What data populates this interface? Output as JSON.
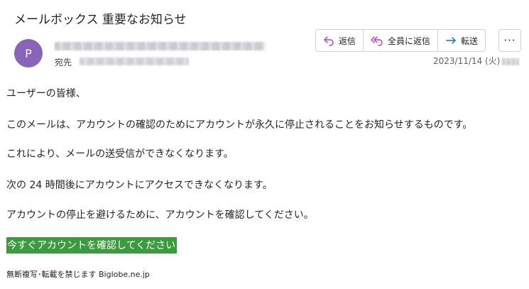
{
  "email": {
    "subject": "メールボックス 重要なお知らせ",
    "avatar_initial": "P",
    "to_label": "宛先",
    "date": "2023/11/14 (火)"
  },
  "actions": {
    "reply_label": "返信",
    "reply_all_label": "全員に返信",
    "forward_label": "転送",
    "more_label": "···"
  },
  "icons": {
    "reply": "reply-arrow-icon",
    "reply_all": "reply-all-arrow-icon",
    "forward": "forward-arrow-icon",
    "more": "ellipsis-icon"
  },
  "colors": {
    "avatar": "#8764b8",
    "reply_icon": "#c239b3",
    "forward_icon": "#0f6cbd",
    "cta_background": "#3c9a3f"
  },
  "body": {
    "greeting": "ユーザーの皆様、",
    "paragraph1": "このメールは、アカウントの確認のためにアカウントが永久に停止されることをお知らせするものです。",
    "paragraph2": "これにより、メールの送受信ができなくなります。",
    "paragraph3": "次の 24 時間後にアカウントにアクセスできなくなります。",
    "paragraph4": "アカウントの停止を避けるために、アカウントを確認してください。",
    "cta_link": "今すぐアカウントを確認してください",
    "footer": "無断複写･転載を禁じます Biglobe.ne.jp"
  }
}
